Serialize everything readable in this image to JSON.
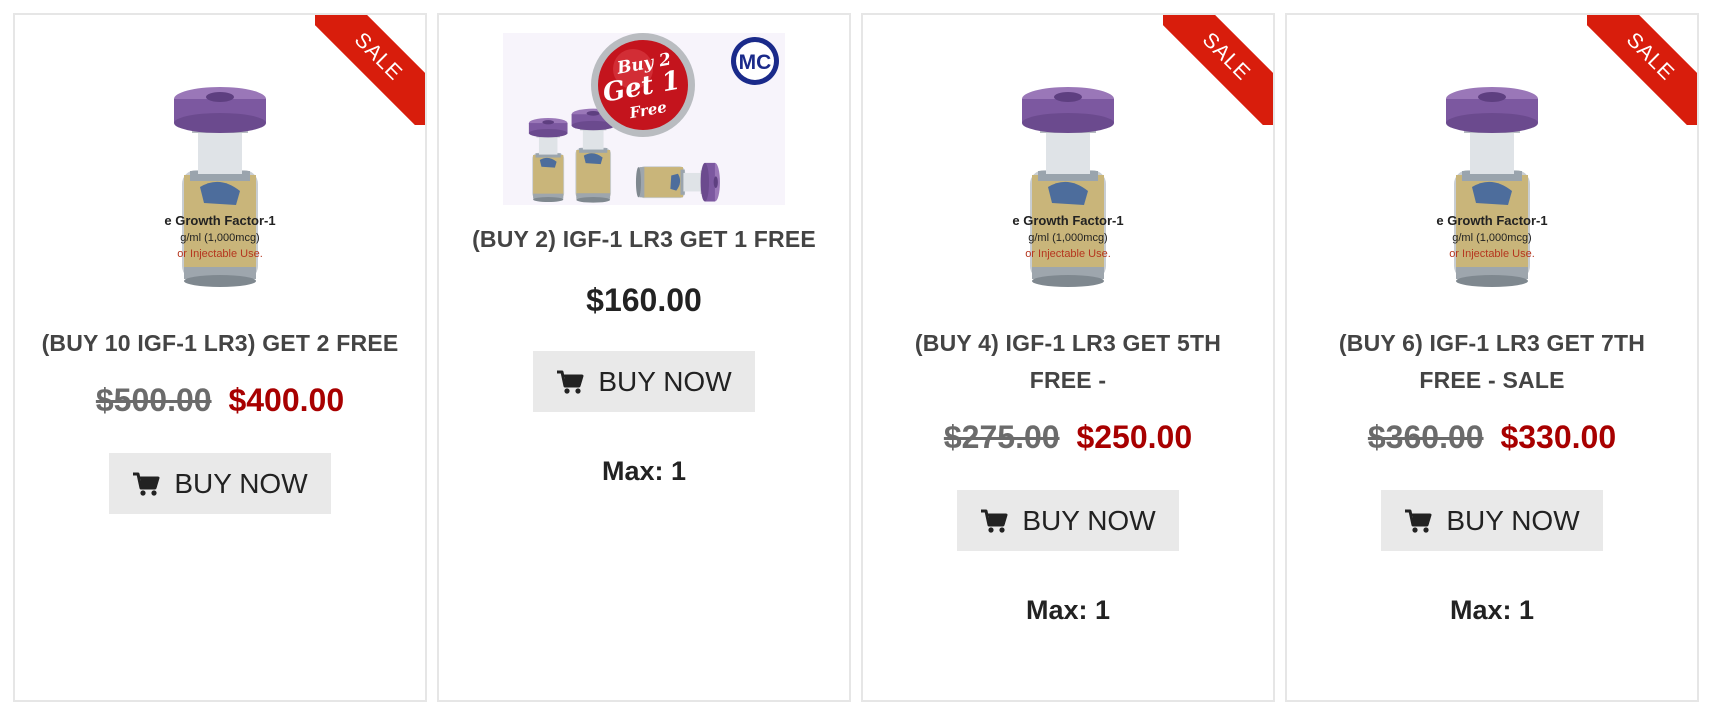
{
  "colors": {
    "sale_ribbon": "#d81d0c",
    "new_price": "#a80000",
    "old_price": "#6b6b6b",
    "button_bg": "#e9e9e9"
  },
  "products": [
    {
      "ribbon": "SALE",
      "title": "(BUY 10 IGF-1 LR3) GET 2 FREE",
      "old_price": "$500.00",
      "new_price": "$400.00",
      "button": "BUY NOW",
      "max": ""
    },
    {
      "ribbon": "",
      "title": "(BUY 2) IGF-1 LR3 GET 1 FREE",
      "price": "$160.00",
      "button": "BUY NOW",
      "max": "Max: 1",
      "promo": {
        "badge_line1": "Buy 2",
        "badge_line2": "Get 1",
        "badge_line3": "Free",
        "logo": "MC"
      }
    },
    {
      "ribbon": "SALE",
      "title": "(BUY 4) IGF-1 LR3 GET 5TH FREE -",
      "old_price": "$275.00",
      "new_price": "$250.00",
      "button": "BUY NOW",
      "max": "Max: 1"
    },
    {
      "ribbon": "SALE",
      "title": "(BUY 6) IGF-1 LR3 GET 7TH FREE - SALE",
      "old_price": "$360.00",
      "new_price": "$330.00",
      "button": "BUY NOW",
      "max": "Max: 1"
    }
  ],
  "vial_label": {
    "line1": "e Growth Factor-1",
    "line2": "g/ml (1,000mcg)",
    "line3": "or Injectable Use."
  },
  "icons": {
    "cart": "shopping-cart-icon"
  }
}
